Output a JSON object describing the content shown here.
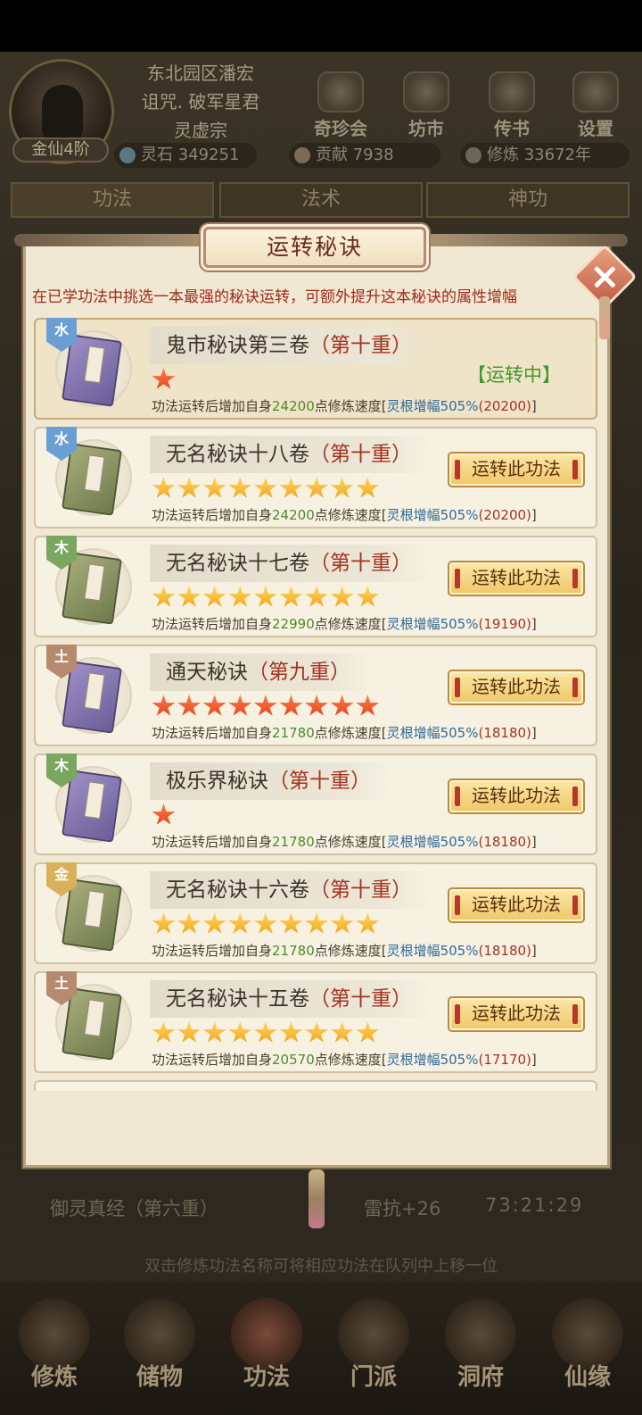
{
  "player": {
    "name_line1": "东北园区潘宏",
    "name_line2": "诅咒. 破军星君",
    "sect": "灵虚宗",
    "realm": "金仙4阶"
  },
  "header_buttons": [
    "奇珍会",
    "坊市",
    "传书",
    "设置"
  ],
  "resources": {
    "lingshi_label": "灵石",
    "lingshi_value": "349251",
    "gongxian_label": "贡献",
    "gongxian_value": "7938",
    "xiulian_label": "修炼",
    "xiulian_value": "33672年"
  },
  "tabs": [
    "功法",
    "法术",
    "神功"
  ],
  "modal": {
    "title": "运转秘诀",
    "description": "在已学功法中挑选一本最强的秘诀运转，可额外提升这本秘诀的属性增幅",
    "run_button_label": "运转此功法",
    "running_label": "【运转中】",
    "info_prefix": "功法运转后增加自身",
    "info_mid": "点修炼速度[",
    "boost_text": "灵根增幅505%",
    "info_suffix": "]",
    "items": [
      {
        "element": "水",
        "element_color": "#6a9fd4",
        "book": "purple",
        "name": "鬼市秘诀第三卷",
        "level": "（第十重）",
        "stars": 1,
        "star_color": "red",
        "speed": "24200",
        "total": "(20200)",
        "active": true
      },
      {
        "element": "水",
        "element_color": "#6a9fd4",
        "book": "green",
        "name": "无名秘诀十八卷",
        "level": "（第十重）",
        "stars": 9,
        "star_color": "gold",
        "speed": "24200",
        "total": "(20200)",
        "active": false
      },
      {
        "element": "木",
        "element_color": "#7aa660",
        "book": "green",
        "name": "无名秘诀十七卷",
        "level": "（第十重）",
        "stars": 9,
        "star_color": "gold",
        "speed": "22990",
        "total": "(19190)",
        "active": false
      },
      {
        "element": "土",
        "element_color": "#b58a6e",
        "book": "purple",
        "name": "通天秘诀",
        "level": "（第九重）",
        "stars": 9,
        "star_color": "red",
        "speed": "21780",
        "total": "(18180)",
        "active": false
      },
      {
        "element": "木",
        "element_color": "#7aa660",
        "book": "purple",
        "name": "极乐界秘诀",
        "level": "（第十重）",
        "stars": 1,
        "star_color": "red",
        "speed": "21780",
        "total": "(18180)",
        "active": false
      },
      {
        "element": "金",
        "element_color": "#d9b15c",
        "book": "green",
        "name": "无名秘诀十六卷",
        "level": "（第十重）",
        "stars": 9,
        "star_color": "gold",
        "speed": "21780",
        "total": "(18180)",
        "active": false
      },
      {
        "element": "土",
        "element_color": "#b58a6e",
        "book": "green",
        "name": "无名秘诀十五卷",
        "level": "（第十重）",
        "stars": 9,
        "star_color": "gold",
        "speed": "20570",
        "total": "(17170)",
        "active": false
      }
    ]
  },
  "queue": {
    "current": "御灵真经（第六重）",
    "effect": "雷抗+26",
    "timer": "73:21:29"
  },
  "hint": "双击修炼功法名称可将相应功法在队列中上移一位",
  "nav": [
    "修炼",
    "储物",
    "功法",
    "门派",
    "洞府",
    "仙缘"
  ]
}
